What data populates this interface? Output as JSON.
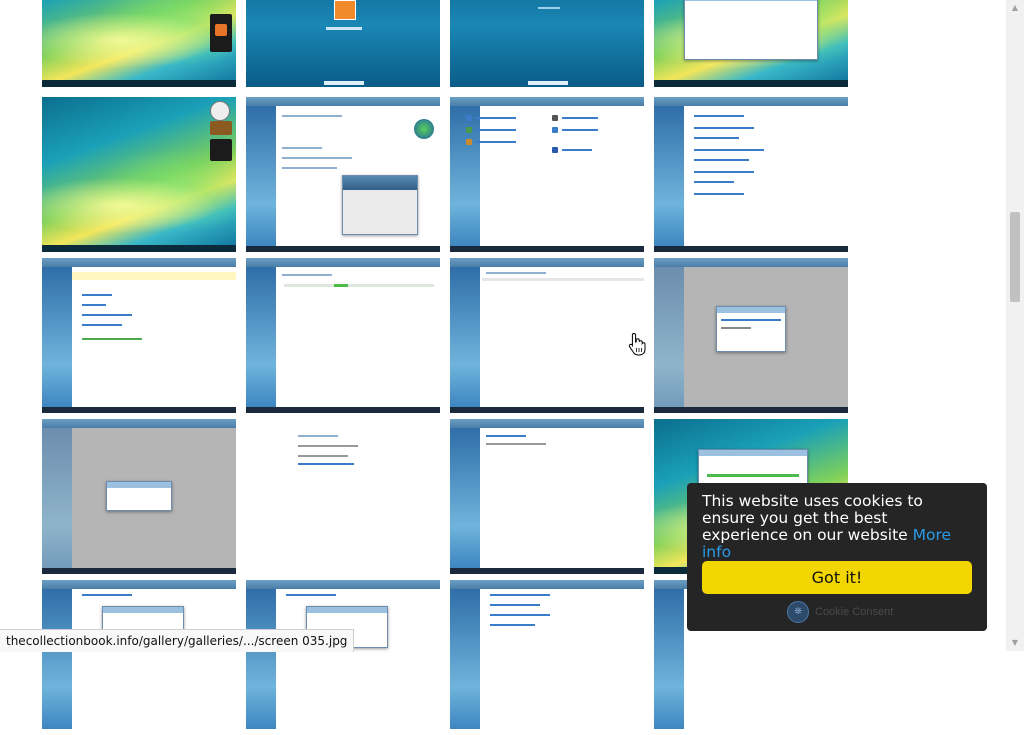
{
  "gallery": {
    "rows": 5,
    "columns": 4
  },
  "cookie_banner": {
    "message": "This website uses cookies to ensure you get the best experience on our website",
    "more_info_label": "More info",
    "accept_label": "Got it!",
    "brand_label": "Cookie Consent"
  },
  "status_bar": {
    "url": "thecollectionbook.info/gallery/galleries/.../screen 035.jpg"
  },
  "colors": {
    "cookie_background": "#252525",
    "accept_button": "#f1d600",
    "link": "#2b9ae6"
  },
  "icons": {
    "cursor": "hand-pointer-icon",
    "scroll_up": "chevron-up-icon",
    "scroll_down": "chevron-down-icon",
    "brand": "cookie-consent-logo-icon"
  }
}
